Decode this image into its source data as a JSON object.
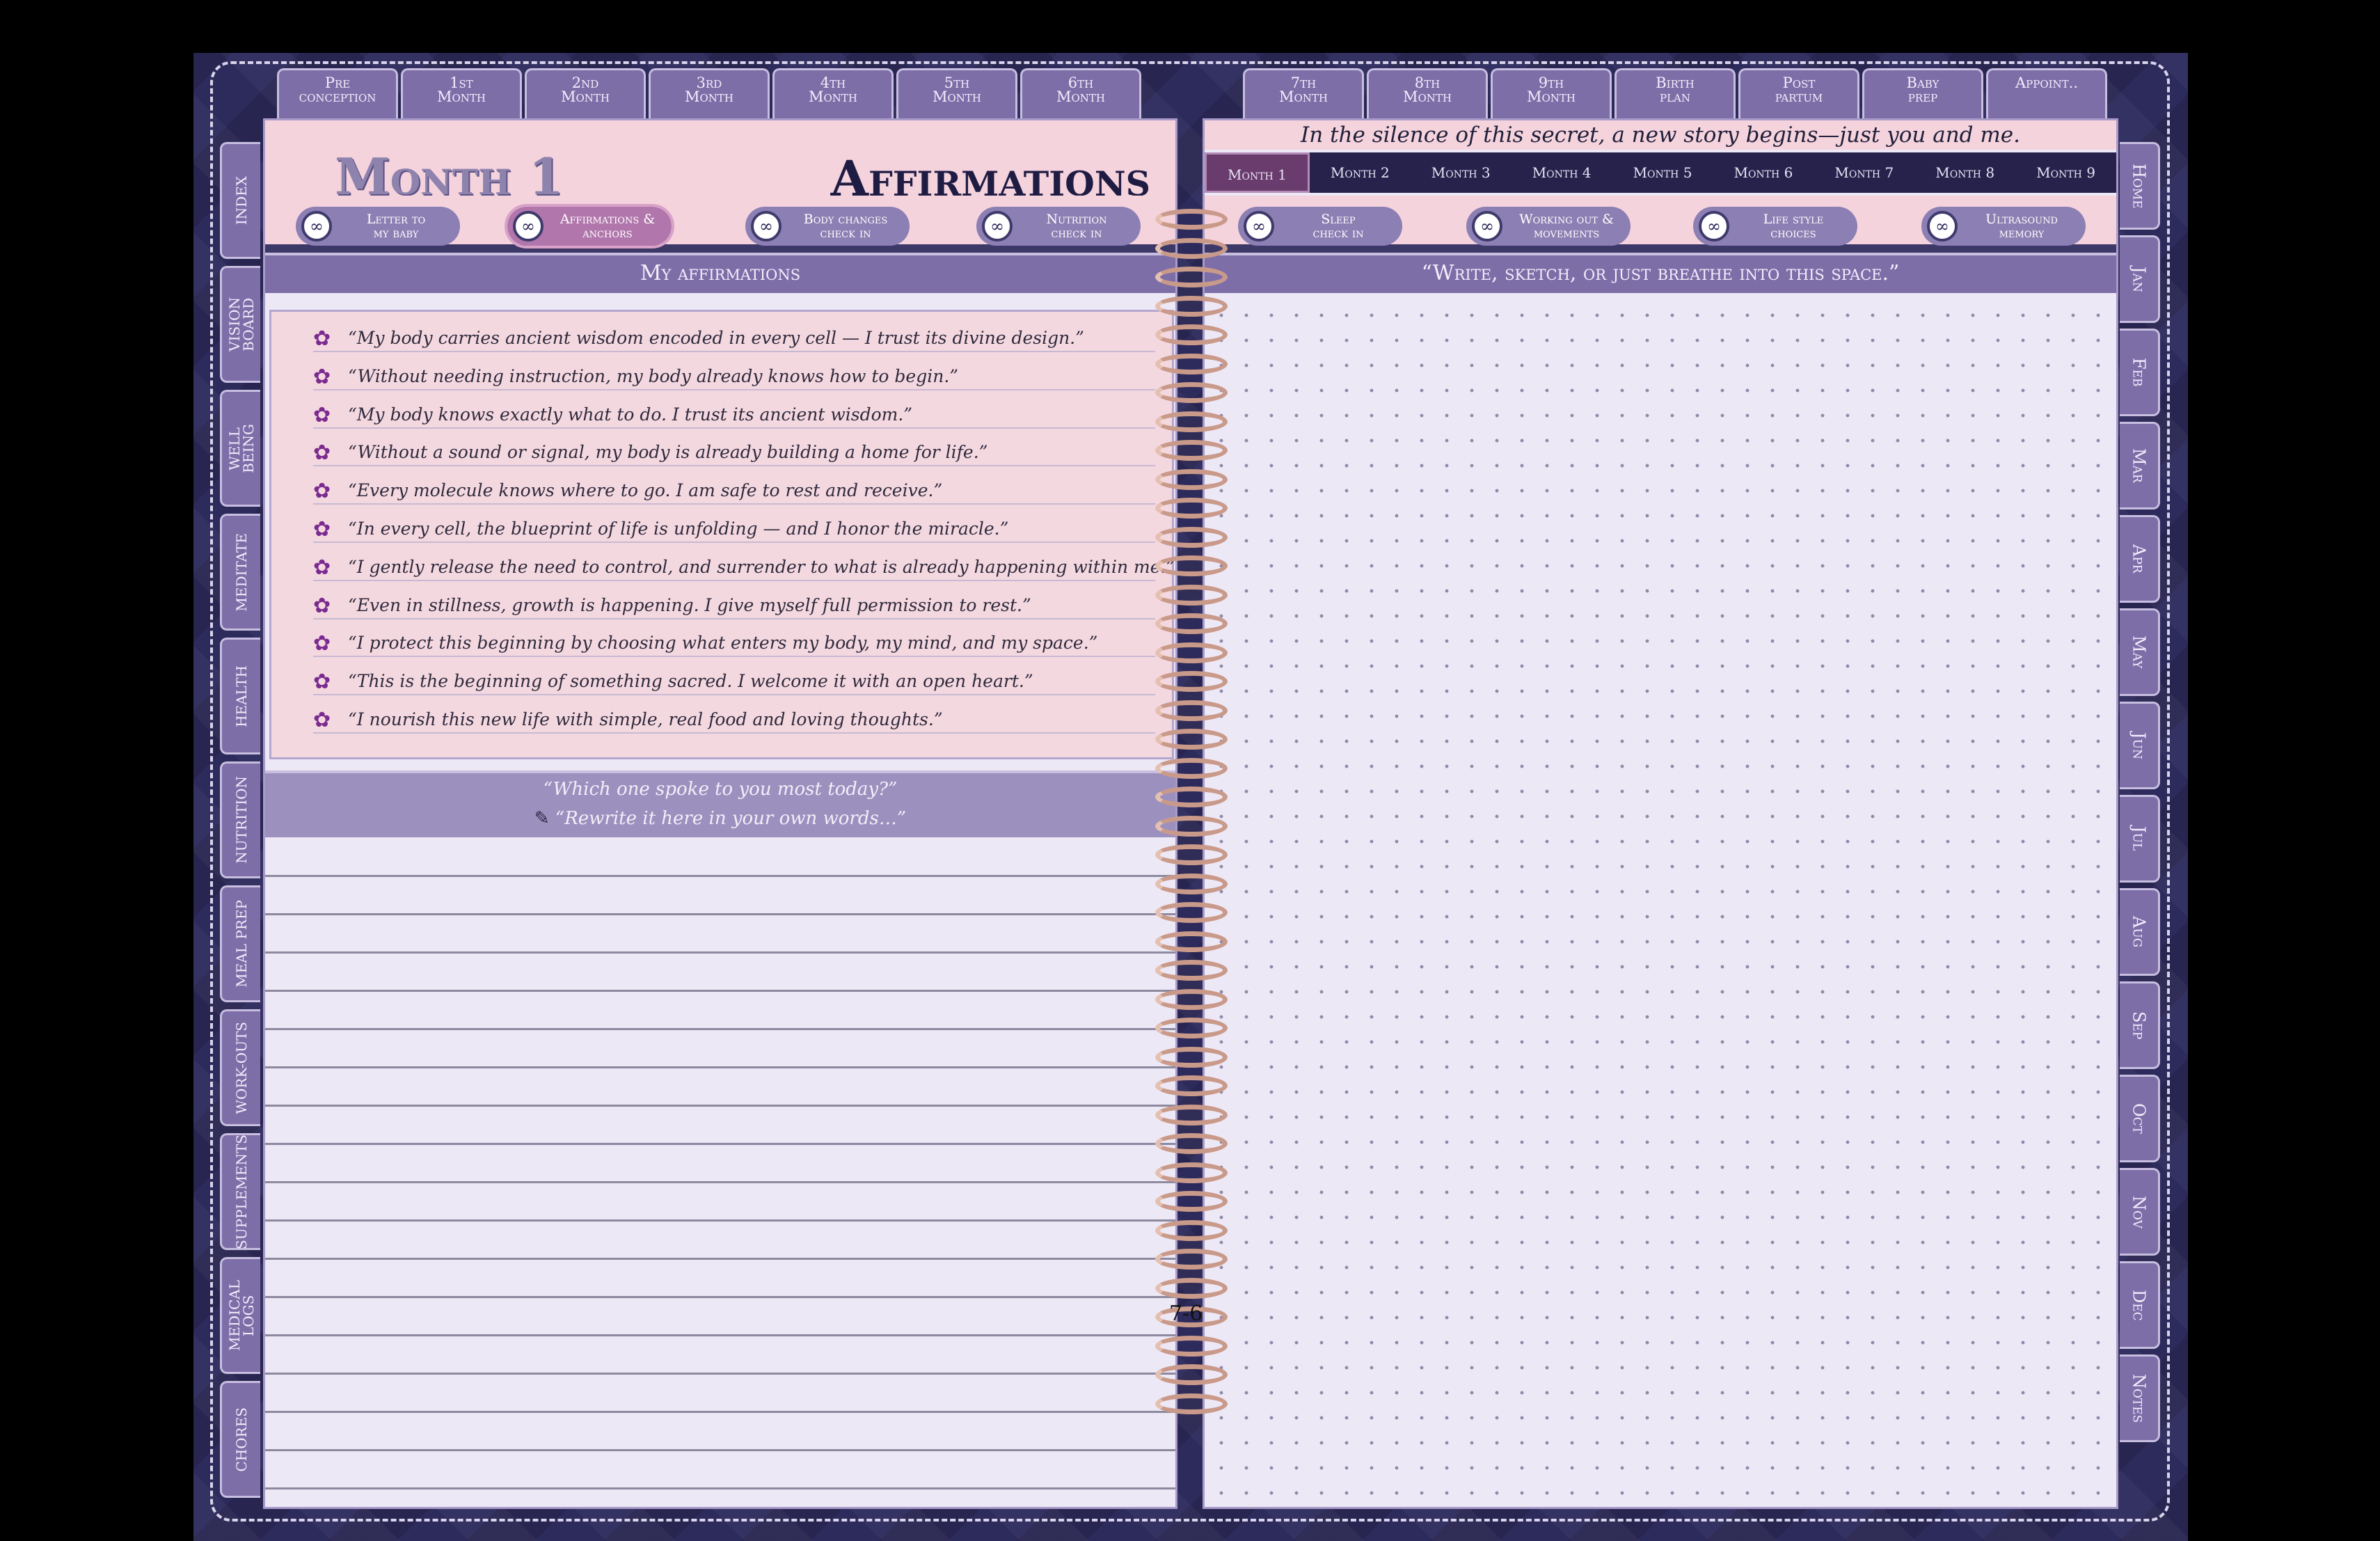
{
  "top_tabs_left": [
    "Pre\nconception",
    "1st\nMonth",
    "2nd\nMonth",
    "3rd\nMonth",
    "4th\nMonth",
    "5th\nMonth",
    "6th\nMonth"
  ],
  "top_tabs_right": [
    "7th\nMonth",
    "8th\nMonth",
    "9th\nMonth",
    "Birth\nplan",
    "Post\npartum",
    "Baby\nprep",
    "Appoint.."
  ],
  "left_tabs": [
    "Index",
    "Vision\nBoard",
    "Well\nBeing",
    "Meditate",
    "Health",
    "Nutrition",
    "Meal Prep",
    "Work-outs",
    "Supplements",
    "Medical\nLogs",
    "Chores"
  ],
  "right_tabs": [
    "Home",
    "Jan",
    "Feb",
    "Mar",
    "Apr",
    "May",
    "Jun",
    "Jul",
    "Aug",
    "Sep",
    "Oct",
    "Nov",
    "Dec",
    "Notes"
  ],
  "left_page": {
    "month_title": "Month 1",
    "section_title": "Affirmations",
    "links": [
      {
        "label": "Letter to\nmy baby",
        "active": false
      },
      {
        "label": "Affirmations &\nanchors",
        "active": true
      },
      {
        "label": "Body changes\ncheck in",
        "active": false
      },
      {
        "label": "Nutrition\ncheck in",
        "active": false
      }
    ],
    "affirmations_header": "My affirmations",
    "affirmations": [
      "“My body carries ancient wisdom encoded in every cell — I trust its divine design.”",
      "“Without needing instruction, my body already knows how to begin.”",
      "“My body knows exactly what to do. I trust its ancient wisdom.”",
      "“Without a sound or signal, my body is already building a home for life.”",
      "“Every molecule knows where to go. I am safe to rest and receive.”",
      "“In every cell, the blueprint of life is unfolding — and I honor the miracle.”",
      "“I gently release the need to control, and surrender to what is already happening within me.”",
      "“Even in stillness, growth is happening. I give myself full permission to rest.”",
      "“I protect this beginning by choosing what enters my body, my mind, and my space.”",
      "“This is the beginning of something sacred. I welcome it with an open heart.”",
      "“I nourish this new life with simple, real food and loving thoughts.”"
    ],
    "prompt_question": "“Which one spoke to you most today?”",
    "prompt_instruction": "“Rewrite it here in your own words…”",
    "page_number": "7-6"
  },
  "right_page": {
    "quote": "In the silence of this secret, a new story begins—just you and me.",
    "month_nav": [
      "Month 1",
      "Month 2",
      "Month 3",
      "Month 4",
      "Month 5",
      "Month 6",
      "Month 7",
      "Month 8",
      "Month 9"
    ],
    "active_month": "Month 1",
    "links": [
      {
        "label": "Sleep\ncheck in"
      },
      {
        "label": "Working out &\nmovements"
      },
      {
        "label": "Life style\nchoices"
      },
      {
        "label": "Ultrasound\nmemory"
      }
    ],
    "header": "“Write, sketch, or just breathe into this space.”"
  },
  "icons": {
    "link": "link-icon",
    "affirmation": "flower-icon",
    "pencil": "pencil-icon"
  },
  "colors": {
    "cover": "#2d2a5c",
    "tab": "#7d6ea8",
    "pink": "#f5d3dd",
    "paper": "#ede8f6"
  }
}
